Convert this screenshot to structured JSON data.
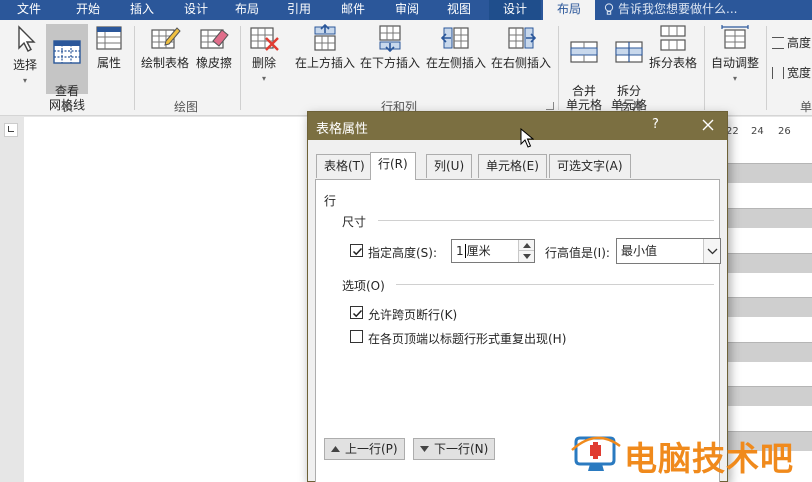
{
  "ribbon_tabs": [
    "文件",
    "开始",
    "插入",
    "设计",
    "布局",
    "引用",
    "邮件",
    "审阅",
    "视图",
    "设计",
    "布局"
  ],
  "tell_me": "告诉我您想要做什么...",
  "groups": {
    "table": {
      "label": "表",
      "buttons": [
        "选择",
        "查看\n网格线",
        "属性"
      ]
    },
    "draw": {
      "label": "绘图",
      "buttons": [
        "绘制表格",
        "橡皮擦"
      ]
    },
    "rows_cols": {
      "label": "行和列",
      "buttons": [
        "删除",
        "在上方插入",
        "在下方插入",
        "在左侧插入",
        "在右侧插入"
      ]
    },
    "merge": {
      "label": "合并",
      "buttons": [
        "合并\n单元格",
        "拆分\n单元格",
        "拆分表格"
      ]
    },
    "cell_size": {
      "buttons": [
        "自动调整"
      ],
      "height_label": "高度",
      "width_label": "宽度",
      "cut_label": "单"
    }
  },
  "ruler_numbers": [
    "22",
    "24",
    "26"
  ],
  "dialog": {
    "title": "表格属性",
    "help": "?",
    "tabs": [
      "表格(T)",
      "行(R)",
      "列(U)",
      "单元格(E)",
      "可选文字(A)"
    ],
    "section_title": "行",
    "size_group": "尺寸",
    "specify_height_label": "指定高度(S):",
    "height_value": "1",
    "height_unit": "厘米",
    "height_rule_label": "行高值是(I):",
    "height_rule_value": "最小值",
    "options_group": "选项(O)",
    "allow_break": "允许跨页断行(K)",
    "repeat_header": "在各页顶端以标题行形式重复出现(H)",
    "prev_row": "上一行(P)",
    "next_row": "下一行(N)"
  },
  "watermark": "电脑技术吧",
  "colors": {
    "ribbon_blue": "#2b579a",
    "dialog_title": "#7b6f41",
    "watermark": "#f08a1c"
  }
}
